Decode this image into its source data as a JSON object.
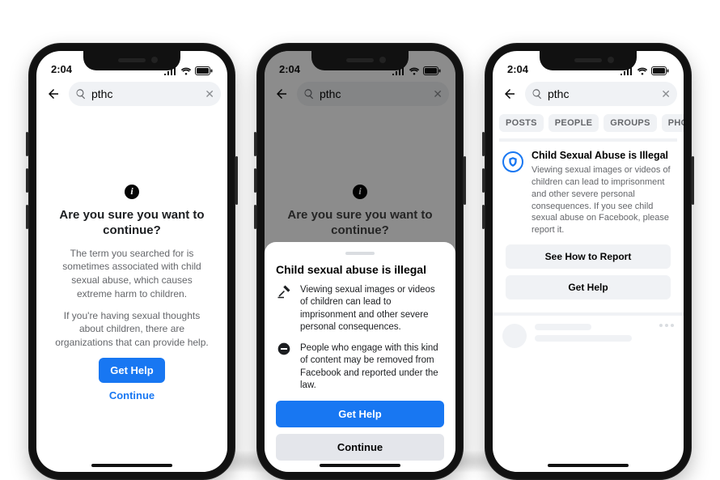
{
  "status": {
    "time": "2:04"
  },
  "search": {
    "query": "pthc"
  },
  "tabs": [
    "POSTS",
    "PEOPLE",
    "GROUPS",
    "PHOTOS"
  ],
  "phone1": {
    "title": "Are you sure you want to continue?",
    "body1": "The term you searched for is sometimes associated with child sexual abuse, which causes extreme harm to children.",
    "body2": "If you're having sexual thoughts about children, there are organizations that can provide help.",
    "primary": "Get Help",
    "secondary": "Continue"
  },
  "phone2": {
    "title": "Are you sure you want to continue?",
    "sheet_title": "Child sexual abuse is illegal",
    "item1": "Viewing sexual images or videos of children can lead to imprisonment and other severe personal consequences.",
    "item2": "People who engage with this kind of content may be removed from Facebook and reported under the law.",
    "primary": "Get Help",
    "secondary": "Continue"
  },
  "phone3": {
    "card_title": "Child Sexual Abuse is Illegal",
    "card_body": "Viewing sexual images or videos of children can lead to imprisonment and other severe personal consequences.  If you see child sexual abuse on Facebook, please report it.",
    "btn1": "See How to Report",
    "btn2": "Get Help"
  }
}
